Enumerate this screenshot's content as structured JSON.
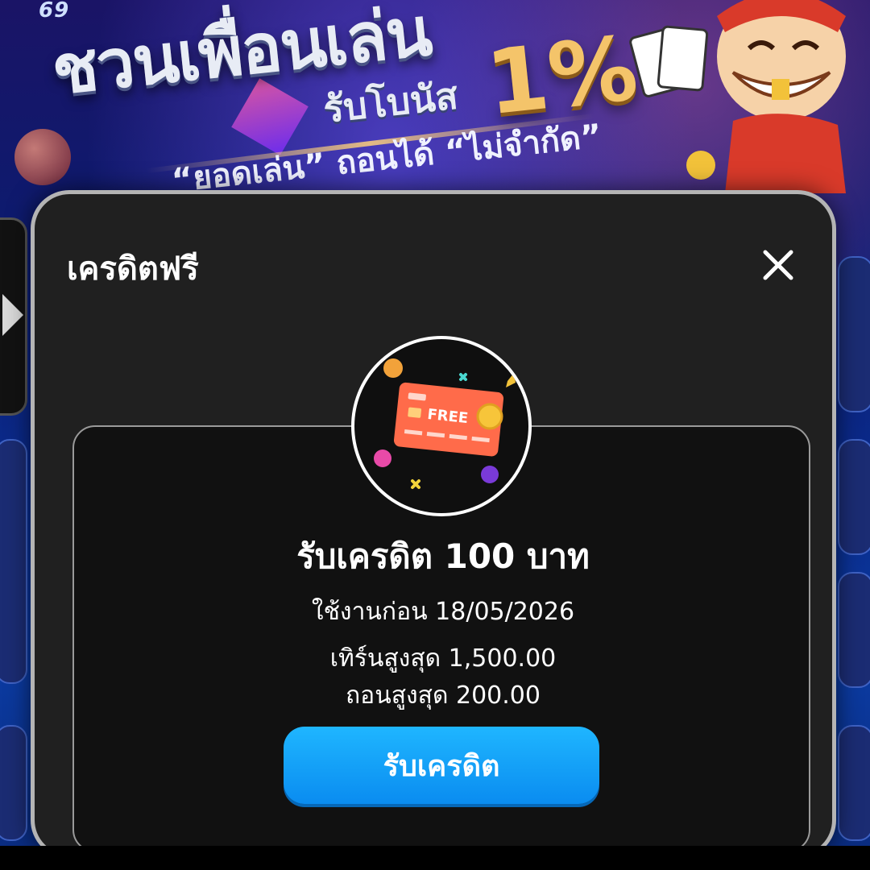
{
  "banner": {
    "logo_text": "69",
    "headline": "ชวนเพื่อนเล่น",
    "subhead": "รับโบนัส",
    "percent": "1%",
    "tagline": "“ยอดเล่น” ถอนได้ “ไม่จำกัด”"
  },
  "modal": {
    "title": "เครดิตฟรี",
    "close_icon": "close-icon"
  },
  "card": {
    "badge_text": "FREE",
    "badge_icon": "free-credit-card-icon",
    "title": "รับเครดิต 100 บาท",
    "expiry": "ใช้งานก่อน 18/05/2026",
    "max_turnover": "เทิร์นสูงสุด 1,500.00",
    "max_withdraw": "ถอนสูงสุด 200.00",
    "claim_button": "รับเครดิต"
  },
  "colors": {
    "modal_bg": "#202020",
    "card_bg": "#111111",
    "button_accent": "#0a8cf0",
    "free_card": "#ff6b4a"
  }
}
